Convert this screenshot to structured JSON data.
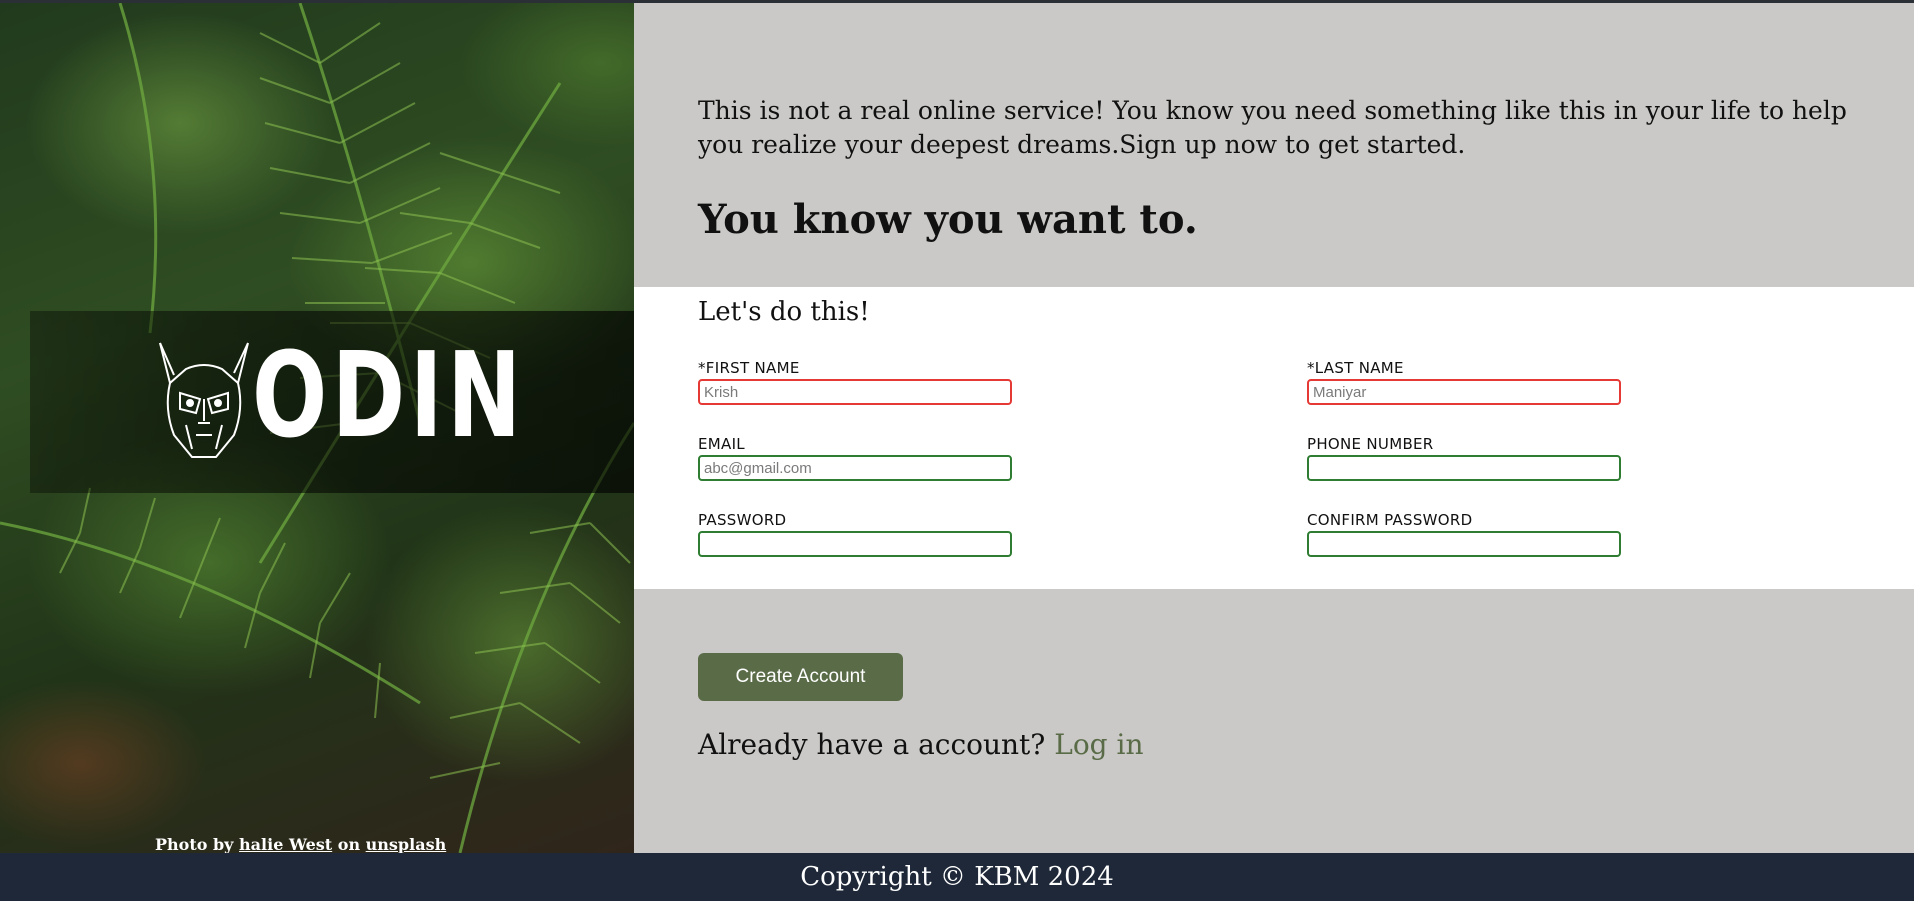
{
  "hero": {
    "logo_text": "ODIN",
    "credit_prefix": "Photo by",
    "credit_author": "halie West",
    "credit_on": "on",
    "credit_site": "unsplash"
  },
  "intro": {
    "text": "This is not a real online service! You know you need something like this in your life to help you realize your deepest dreams.Sign up now to get started.",
    "tagline": "You know you want to."
  },
  "form": {
    "title": "Let's do this!",
    "fields": [
      {
        "label": "*FIRST NAME",
        "placeholder": "Krish",
        "state": "invalid"
      },
      {
        "label": "*LAST NAME",
        "placeholder": "Maniyar",
        "state": "invalid"
      },
      {
        "label": "EMAIL",
        "placeholder": "abc@gmail.com",
        "state": "valid"
      },
      {
        "label": "PHONE NUMBER",
        "placeholder": "",
        "state": "valid"
      },
      {
        "label": "PASSWORD",
        "placeholder": "",
        "state": "valid"
      },
      {
        "label": "CONFIRM PASSWORD",
        "placeholder": "",
        "state": "valid"
      }
    ],
    "submit_label": "Create Account",
    "login_prompt": "Already have a account?",
    "login_link": "Log in"
  },
  "footer": {
    "copyright": "Copyright © KBM 2024"
  },
  "colors": {
    "accent": "#596b47",
    "invalid_border": "#e53935",
    "valid_border": "#2e7d32",
    "footer_bg": "#1e2838",
    "page_bg": "#cac9c7"
  }
}
